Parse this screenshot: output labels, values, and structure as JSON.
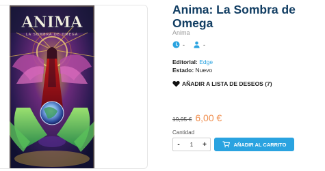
{
  "product": {
    "cover_title": "ANIMA",
    "cover_subtitle": "LA SOMBRA DE OMEGA",
    "title": "Anima: La Sombra de Omega",
    "author": "Anima",
    "players_value": "-",
    "age_value": "-",
    "publisher_label": "Editorial:",
    "publisher": "Edge",
    "status_label": "Estado:",
    "status": "Nuevo",
    "wishlist_label": "AÑADIR A LISTA DE DESEOS (7)",
    "old_price": "19,95 €",
    "price": "6,00 €",
    "quantity_label": "Cantidad",
    "quantity": "1",
    "minus": "-",
    "plus": "+",
    "add_to_cart": "AÑADIR AL CARRITO"
  },
  "colors": {
    "title": "#123e63",
    "accent": "#2aa3e0",
    "price": "#f08f4f"
  },
  "icons": {
    "players": "clock-icon",
    "age": "user-icon",
    "wishlist": "heart-icon",
    "cart": "cart-icon"
  }
}
